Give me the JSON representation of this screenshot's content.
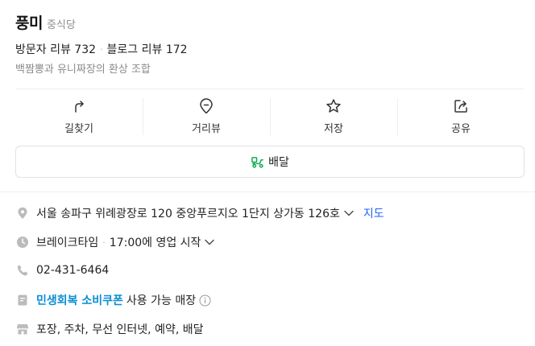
{
  "place": {
    "name": "풍미",
    "category": "중식당",
    "visitor_reviews": "방문자 리뷰 732",
    "blog_reviews": "블로그 리뷰 172",
    "separator": "·",
    "description": "백짬뽕과 유니짜장의 환상 조합"
  },
  "actions": [
    {
      "label": "길찾기",
      "icon": "directions-icon"
    },
    {
      "label": "거리뷰",
      "icon": "map-pin-icon"
    },
    {
      "label": "저장",
      "icon": "star-icon"
    },
    {
      "label": "공유",
      "icon": "share-icon"
    }
  ],
  "delivery": {
    "label": "배달",
    "icon": "delivery-scooter-icon"
  },
  "info": {
    "address": "서울 송파구 위례광장로 120 중앙푸르지오 1단지 상가동 126호",
    "map_link": "지도",
    "hours_status": "브레이크타임",
    "hours_detail": "17:00에 영업 시작",
    "phone": "02-431-6464",
    "coupon_name": "민생회복 소비쿠폰",
    "coupon_suffix": "사용 가능 매장",
    "amenities": "포장, 주차, 무선 인터넷, 예약, 배달"
  },
  "colors": {
    "link_blue": "#2260ff",
    "coupon_blue": "#0a8dd4",
    "delivery_green": "#03a94d",
    "icon_gray": "#bbbbbb"
  }
}
